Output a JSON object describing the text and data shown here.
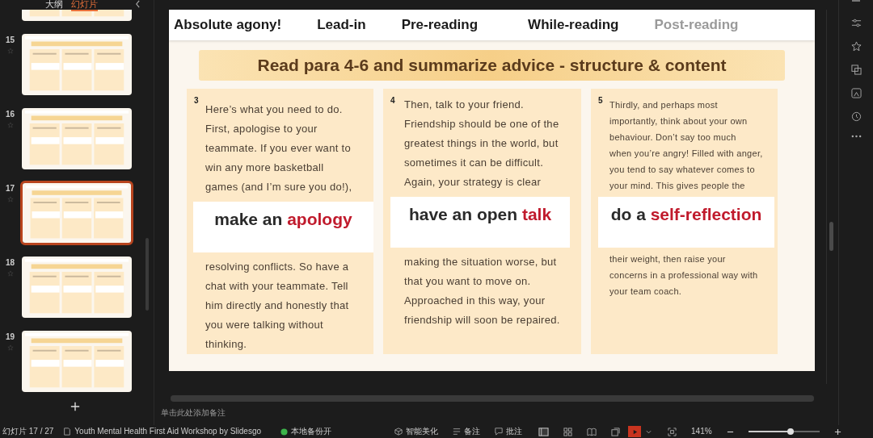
{
  "sidebar": {
    "tabs": [
      {
        "label": "大纲",
        "selected": false
      },
      {
        "label": "幻灯片",
        "selected": true
      }
    ],
    "thumbnails": [
      {
        "kind": "partial",
        "selected": false
      },
      {
        "kind": "full",
        "number": "15",
        "selected": false
      },
      {
        "kind": "full",
        "number": "16",
        "selected": false
      },
      {
        "kind": "full",
        "number": "17",
        "selected": true
      },
      {
        "kind": "full",
        "number": "18",
        "selected": false
      },
      {
        "kind": "full",
        "number": "19",
        "selected": false
      }
    ]
  },
  "slide": {
    "nav": [
      {
        "label": "Absolute agony!",
        "muted": false
      },
      {
        "label": "Lead-in",
        "muted": false
      },
      {
        "label": "Pre-reading",
        "muted": false
      },
      {
        "label": "While-reading",
        "muted": false
      },
      {
        "label": "Post-reading",
        "muted": true
      }
    ],
    "title": "Read para 4-6 and summarize advice - structure & content",
    "columns": [
      {
        "number": "3",
        "top_lines": [
          "Here’s what you need to do.",
          "First, apologise to your",
          "teammate. If you ever want to",
          "win any more basketball",
          "games (and I’m sure you do!),"
        ],
        "phrase": {
          "lead": "make an",
          "key": "apology"
        },
        "bottom_lines": [
          "resolving conflicts. So have a",
          "chat with your teammate. Tell",
          "him directly and honestly that",
          "you were talking without",
          "thinking."
        ]
      },
      {
        "number": "4",
        "top_lines": [
          "Then, talk to your friend.",
          "Friendship should be one of the",
          "greatest things in the world, but",
          "sometimes it can be difficult.",
          "Again, your strategy is clear"
        ],
        "phrase": {
          "lead": "have an open",
          "key": "talk"
        },
        "bottom_lines": [
          "making the situation worse, but",
          "that you want to move on.",
          "Approached in this way, your",
          "friendship will soon be repaired."
        ]
      },
      {
        "number": "5",
        "top_lines": [
          "Thirdly, and perhaps most",
          "importantly, think about your own",
          "behaviour. Don’t say too much",
          "when you’re angry! Filled with anger,",
          "you tend to say whatever comes to",
          "your mind. This gives people the"
        ],
        "phrase": {
          "lead": "do a",
          "key": "self-reflection"
        },
        "bottom_lines": [
          "their weight, then raise your",
          "concerns in a professional way with",
          "your team coach."
        ]
      }
    ]
  },
  "notes": {
    "placeholder": "单击此处添加备注"
  },
  "status_bar": {
    "slide_counter": "幻灯片 17 / 27",
    "document": "Youth Mental Health First Aid Workshop by Slidesgo",
    "backup": "本地备份开",
    "beautify": "智能美化",
    "notes": "备注",
    "comments": "批注",
    "zoom": "141%",
    "zoom_slider": {
      "level": 0.6
    }
  }
}
